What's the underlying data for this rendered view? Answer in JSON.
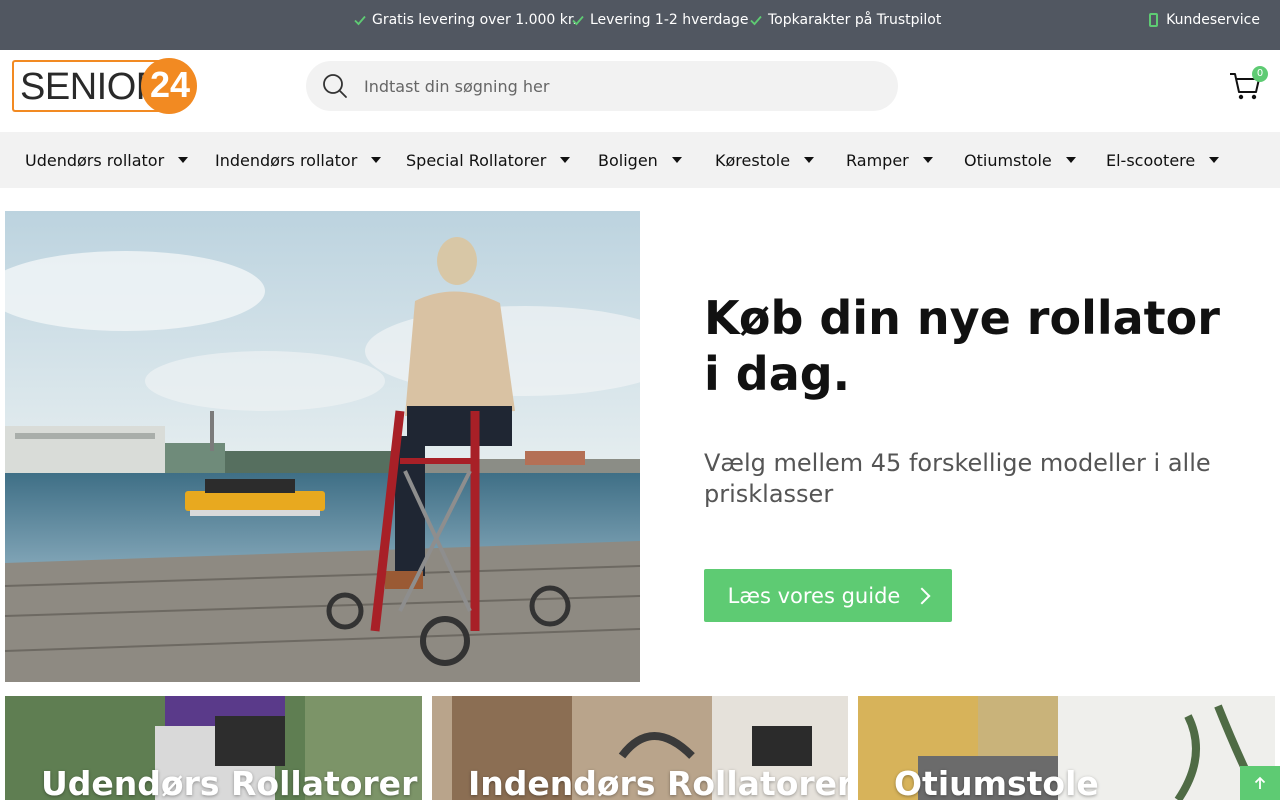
{
  "topbar": {
    "usps": [
      "Gratis levering over 1.000 kr.",
      "Levering 1-2 hverdage",
      "Topkarakter på Trustpilot"
    ],
    "customer_service": "Kundeservice"
  },
  "header": {
    "logo_text": "SENIOR",
    "logo_number": "24",
    "search_placeholder": "Indtast din søgning her",
    "cart_count": "0"
  },
  "nav": {
    "items": [
      "Udendørs rollator",
      "Indendørs rollator",
      "Special Rollatorer",
      "Boligen",
      "Kørestole",
      "Ramper",
      "Otiumstole",
      "El-scootere"
    ]
  },
  "hero": {
    "title": "Køb din nye rollator i dag.",
    "subtitle": "Vælg mellem 45 forskellige modeller i alle prisklasser",
    "button_label": "Læs vores guide"
  },
  "categories": [
    "Udendørs Rollatorer",
    "Indendørs Rollatorer",
    "Otiumstole"
  ],
  "colors": {
    "topbar": "#515761",
    "accent": "#5ecb73",
    "logo_orange": "#f28a22",
    "nav_bg": "#f2f2f2"
  }
}
